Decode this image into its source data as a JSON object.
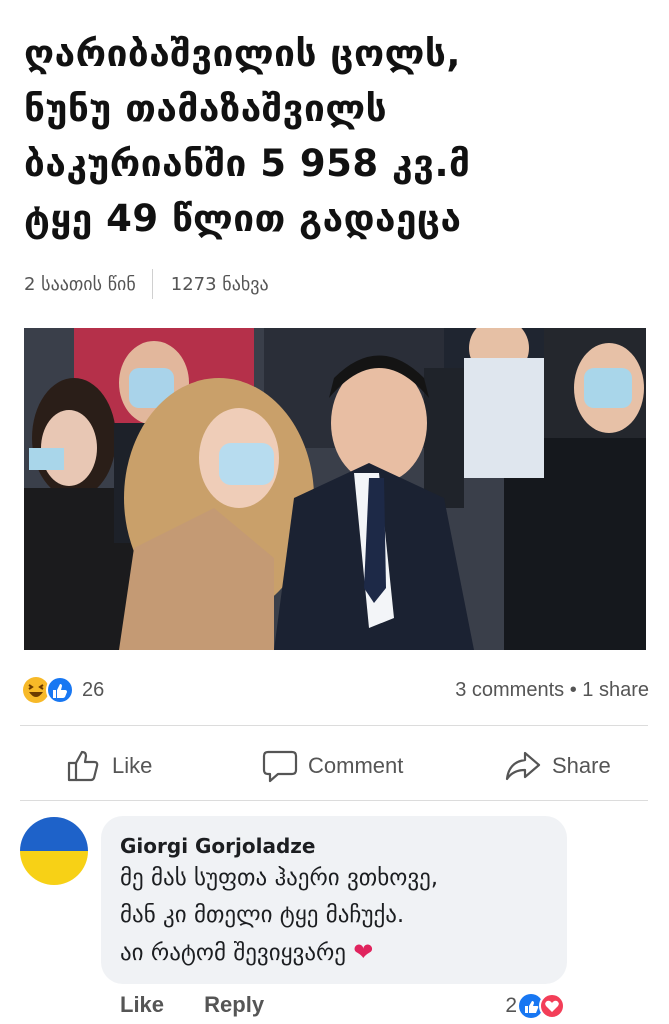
{
  "article": {
    "headline_lines": [
      "ღარიბაშვილის ცოლს,",
      "ნუნუ თამაზაშვილს",
      "ბაკურიანში 5 958 კვ.მ",
      "ტყე 49 წლით გადაეცა"
    ],
    "time_ago": "2 საათის წინ",
    "views": "1273 ნახვა"
  },
  "post_stats": {
    "reaction_count": "26",
    "comments": "3 comments",
    "dot": "•",
    "shares": "1 share",
    "reaction_icons": [
      "haha-icon",
      "like-icon"
    ]
  },
  "actions": {
    "like": "Like",
    "comment": "Comment",
    "share": "Share"
  },
  "comment": {
    "author": "Giorgi Gorjoladze",
    "lines": [
      "მე მას სუფთა ჰაერი ვთხოვე,",
      "მან კი მთელი ტყე მაჩუქა.",
      "აი რატომ შევიყვარე"
    ],
    "like_label": "Like",
    "reply_label": "Reply",
    "reaction_count": "2",
    "avatar_colors": {
      "top": "#1e62c9",
      "bottom": "#f7d116"
    }
  },
  "colors": {
    "like_blue": "#1877f2",
    "love_red": "#f33e58",
    "haha_yellow": "#f7b928"
  }
}
